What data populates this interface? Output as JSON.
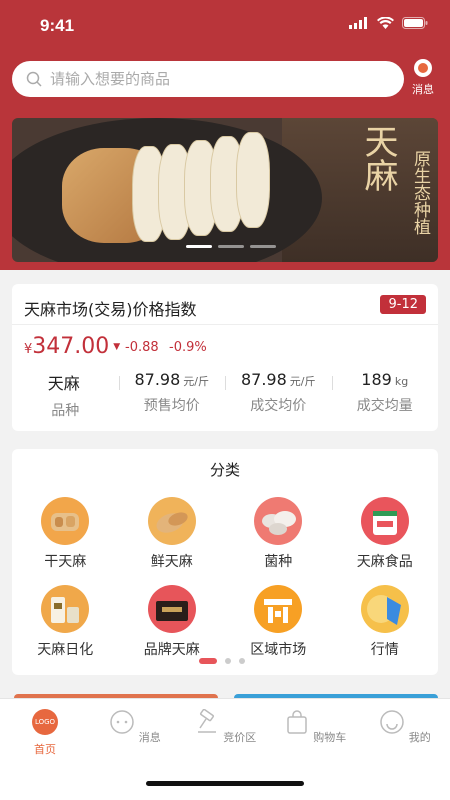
{
  "status": {
    "time": "9:41"
  },
  "search": {
    "placeholder": "请输入想要的商品"
  },
  "header": {
    "message_label": "消息"
  },
  "banner": {
    "title": "天麻",
    "subtitle": "原生态种植",
    "slides": 3,
    "active_slide": 0
  },
  "price_index": {
    "title": "天麻市场(交易)价格指数",
    "date": "9-12",
    "currency": "¥",
    "price": "347.00",
    "change": "-0.88",
    "change_pct": "-0.9%",
    "stats": [
      {
        "value": "天麻",
        "unit": "",
        "label": "品种"
      },
      {
        "value": "87.98",
        "unit": "元/斤",
        "label": "预售均价"
      },
      {
        "value": "87.98",
        "unit": "元/斤",
        "label": "成交均价"
      },
      {
        "value": "189",
        "unit": "kg",
        "label": "成交均量"
      }
    ]
  },
  "categories": {
    "title": "分类",
    "items": [
      {
        "label": "干天麻",
        "icon": "dried-tianma-icon",
        "color": "#f2a64a"
      },
      {
        "label": "鲜天麻",
        "icon": "fresh-tianma-icon",
        "color": "#f0b35a"
      },
      {
        "label": "菌种",
        "icon": "mushroom-icon",
        "color": "#ef7a72"
      },
      {
        "label": "天麻食品",
        "icon": "food-jar-icon",
        "color": "#e9555c"
      },
      {
        "label": "天麻日化",
        "icon": "cosmetics-icon",
        "color": "#f0a84a"
      },
      {
        "label": "品牌天麻",
        "icon": "brand-box-icon",
        "color": "#e7555a"
      },
      {
        "label": "区域市场",
        "icon": "market-icon",
        "color": "#f7a024"
      },
      {
        "label": "行情",
        "icon": "trend-icon",
        "color": "#f6c04a"
      }
    ],
    "pages": 3,
    "active_page": 0
  },
  "tabbar": {
    "items": [
      {
        "label": "首页",
        "icon": "logo-icon",
        "active": true
      },
      {
        "label": "消息",
        "icon": "chat-icon",
        "active": false
      },
      {
        "label": "竞价区",
        "icon": "gavel-icon",
        "active": false
      },
      {
        "label": "购物车",
        "icon": "bag-icon",
        "active": false
      },
      {
        "label": "我的",
        "icon": "profile-icon",
        "active": false
      }
    ],
    "logo_text": "LOGO"
  },
  "colors": {
    "primary": "#b9353a",
    "accent": "#e7683f",
    "price_red": "#c2303a"
  }
}
